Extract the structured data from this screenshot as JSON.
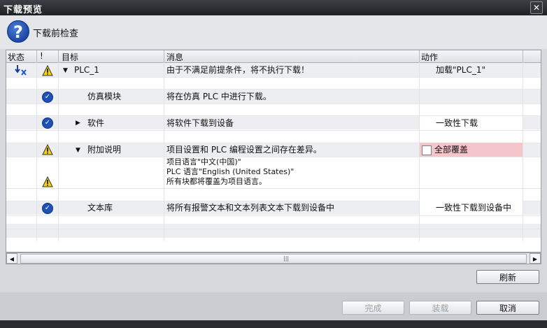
{
  "window": {
    "title": "下载预览",
    "close_glyph": "✕"
  },
  "header": {
    "text": "下载前检查"
  },
  "columns": {
    "status": "状态",
    "flag": "!",
    "target": "目标",
    "message": "消息",
    "action": "动作"
  },
  "rows": [
    {
      "target": "PLC_1",
      "message": "由于不满足前提条件，将不执行下载！",
      "action": "加载\"PLC_1\""
    },
    {
      "target": "仿真模块",
      "message": "将在仿真 PLC 中进行下载。"
    },
    {
      "target": "软件",
      "message": "将软件下载到设备",
      "action": "一致性下载"
    },
    {
      "target": "附加说明",
      "message": "项目设置和 PLC 编程设置之间存在差异。",
      "action": "全部覆盖"
    },
    {
      "message_lines": [
        "项目语言\"中文(中国)\"",
        "PLC 语言\"English (United States)\"",
        "所有块都将覆盖为项目语言。"
      ]
    },
    {
      "target": "文本库",
      "message": "将所有报警文本和文本列表文本下载到设备中",
      "action": "一致性下载到设备中"
    }
  ],
  "scrollbar": {
    "left": "◀",
    "right": "▶",
    "grip": "|||"
  },
  "buttons": {
    "refresh": "刷新",
    "finish": "完成",
    "load": "装载",
    "cancel": "取消"
  }
}
